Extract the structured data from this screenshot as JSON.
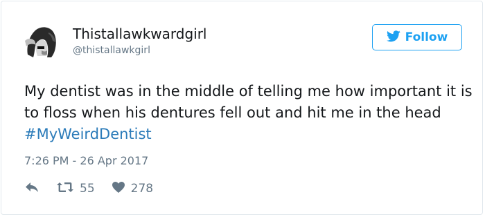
{
  "user": {
    "display_name": "Thistallawkwardgirl",
    "handle": "@thistallawkgirl"
  },
  "follow": {
    "label": "Follow",
    "icon": "bird-icon"
  },
  "tweet": {
    "text": "My dentist was in the middle of telling me how important it is to floss when his dentures fell out and hit me in the head ",
    "hashtag": "#MyWeirdDentist",
    "timestamp": "7:26 PM - 26 Apr 2017"
  },
  "actions": {
    "reply_icon": "reply-icon",
    "retweet_icon": "retweet-icon",
    "retweet_count": "55",
    "like_icon": "heart-icon",
    "like_count": "278"
  },
  "colors": {
    "accent": "#1da1f2",
    "hashtag": "#2b7bb9",
    "secondary_text": "#657786",
    "primary_text": "#14171a",
    "border": "#e1e8ed"
  }
}
